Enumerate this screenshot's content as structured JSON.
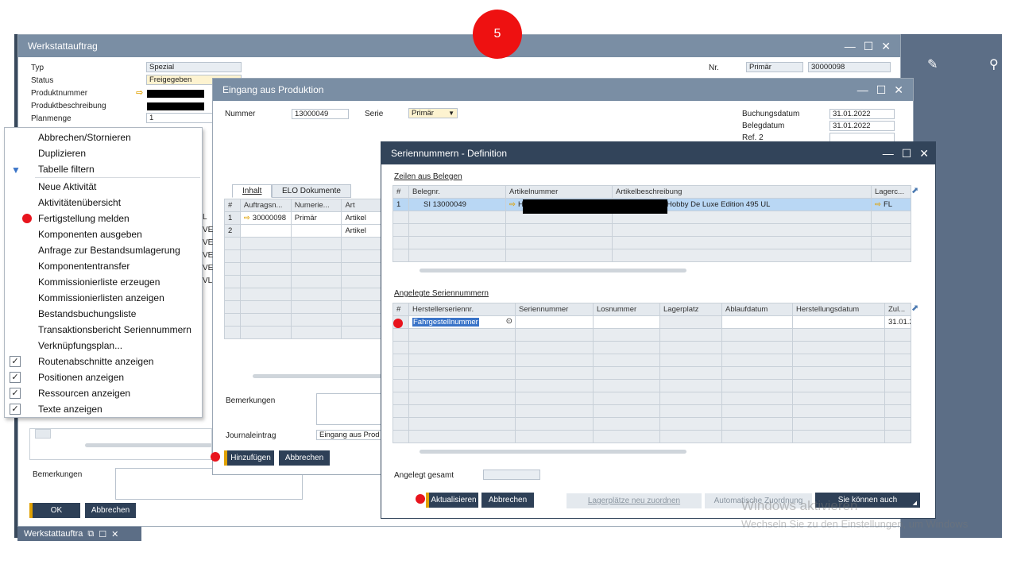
{
  "step_badge": "5",
  "werkstatt": {
    "title": "Werkstattauftrag",
    "labels": [
      "Typ",
      "Status",
      "Produktnummer",
      "Produktbeschreibung",
      "Planmenge"
    ],
    "typ": "Spezial",
    "status": "Freigegeben",
    "planmenge": "1",
    "nr_label": "Nr.",
    "nr_serie": "Primär",
    "nr_value": "30000098",
    "bemerkungen_label": "Bemerkungen",
    "ok": "OK",
    "abbrechen": "Abbrechen",
    "taskbar_title": "Werkstattauftra"
  },
  "eingang": {
    "title": "Eingang aus Produktion",
    "nummer_label": "Nummer",
    "nummer_value": "13000049",
    "serie_label": "Serie",
    "serie_value": "Primär",
    "buchungsdatum_label": "Buchungsdatum",
    "buchungsdatum_value": "31.01.2022",
    "belegdatum_label": "Belegdatum",
    "belegdatum_value": "31.01.2022",
    "ref_label": "Ref. 2",
    "tabs": [
      "Inhalt",
      "ELO Dokumente"
    ],
    "columns": [
      "#",
      "Auftragsn...",
      "Numerie...",
      "Art"
    ],
    "rows": [
      {
        "n": "1",
        "auftrag": "30000098",
        "serie": "Primär",
        "art": "Artikel"
      },
      {
        "n": "2",
        "auftrag": "",
        "serie": "",
        "art": "Artikel"
      }
    ],
    "bemerkungen_label": "Bemerkungen",
    "journal_label": "Journaleintrag",
    "journal_value": "Eingang aus Prod",
    "hinzufuegen": "Hinzufügen",
    "abbrechen": "Abbrechen"
  },
  "serien": {
    "title": "Seriennummern - Definition",
    "section1": "Zeilen aus Belegen",
    "cols1": [
      "#",
      "Belegnr.",
      "Artikelnummer",
      "Artikelbeschreibung",
      "Lagerc..."
    ],
    "row1": {
      "n": "1",
      "beleg": "SI 13000049",
      "artnr_prefix": "H",
      "desc": "Hobby De Luxe Edition 495 UL",
      "lager": "FL"
    },
    "section2": "Angelegte Seriennummern",
    "cols2": [
      "#",
      "Herstellerseriennr.",
      "Seriennummer",
      "Losnummer",
      "Lagerplatz",
      "Ablaufdatum",
      "Herstellungsdatum",
      "Zul..."
    ],
    "row2": {
      "hersteller": "Fahrgestellnummer",
      "zul": "31.01.2"
    },
    "angelegt_label": "Angelegt gesamt",
    "aktualisieren": "Aktualisieren",
    "abbrechen": "Abbrechen",
    "lagerplaetze": "Lagerplätze neu zuordnen",
    "automatische": "Automatische Zuordnung",
    "sie_koennen": "Sie können auch"
  },
  "menu": {
    "items": [
      {
        "label": "Abbrechen/Stornieren",
        "check": false
      },
      {
        "label": "Duplizieren",
        "check": false
      },
      {
        "label": "Tabelle filtern",
        "check": false
      },
      {
        "label": "Neue Aktivität",
        "check": false
      },
      {
        "label": "Aktivitätenübersicht",
        "check": false
      },
      {
        "label": "Fertigstellung melden",
        "check": false
      },
      {
        "label": "Komponenten ausgeben",
        "check": false
      },
      {
        "label": "Anfrage zur Bestandsumlagerung",
        "check": false
      },
      {
        "label": "Komponententransfer",
        "check": false
      },
      {
        "label": "Kommissionierliste erzeugen",
        "check": false
      },
      {
        "label": "Kommissionierlisten anzeigen",
        "check": false
      },
      {
        "label": "Bestandsbuchungsliste",
        "check": false
      },
      {
        "label": "Transaktionsbericht Seriennummern",
        "check": false
      },
      {
        "label": "Verknüpfungsplan...",
        "check": false
      },
      {
        "label": "Routenabschnitte anzeigen",
        "check": true
      },
      {
        "label": "Positionen anzeigen",
        "check": true
      },
      {
        "label": "Ressourcen anzeigen",
        "check": true
      },
      {
        "label": "Texte anzeigen",
        "check": true
      }
    ],
    "side_letters": [
      "L",
      "VE",
      "VE",
      "VE",
      "VE",
      "VL"
    ]
  },
  "watermark": {
    "line1": "Windows aktivieren",
    "line2": "Wechseln Sie zu den Einstellungen, um Windows"
  },
  "colors": {
    "accent": "#e0a100",
    "button": "#2e4057",
    "dark_title": "#32445a",
    "grey_title": "#7a8ea4",
    "dot": "#e8141d"
  }
}
